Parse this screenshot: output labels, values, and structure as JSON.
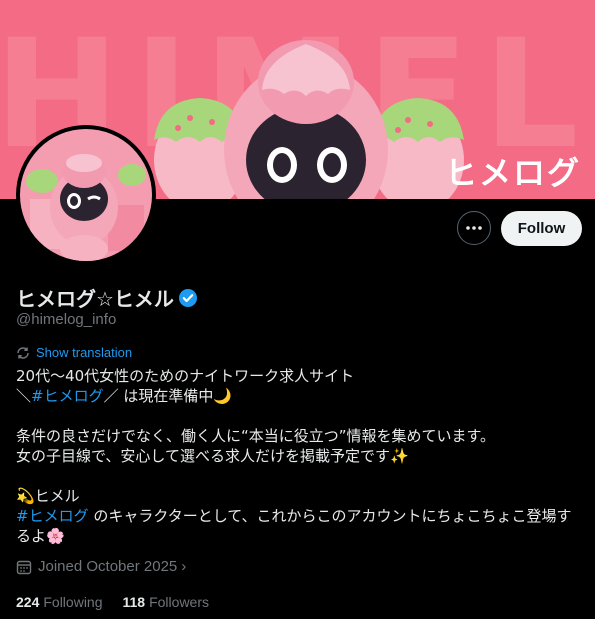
{
  "banner": {
    "background_text": "HIMELOG",
    "logo_text": "ヒメログ"
  },
  "profile": {
    "name": "ヒメログ☆ヒメル",
    "handle": "@himelog_info",
    "verified": true
  },
  "actions": {
    "more_icon": "more-dots-icon",
    "follow_label": "Follow"
  },
  "translate_label": "Show translation",
  "bio": {
    "line1": "20代〜40代女性のためのナイトワーク求人サイト",
    "line2_prefix": "＼",
    "line2_tag": "#ヒメログ",
    "line2_suffix": "／ は現在準備中🌙",
    "line3": "条件の良さだけでなく、働く人に“本当に役立つ”情報を集めています。",
    "line4": "女の子目線で、安心して選べる求人だけを掲載予定です✨",
    "line5": "💫ヒメル",
    "line6_tag": "#ヒメログ",
    "line6_text": " のキャラクターとして、これからこのアカウントにちょこちょこ登場す",
    "line7": "るよ🌸"
  },
  "joined": "Joined October 2025",
  "stats": {
    "following_count": "224",
    "following_label": "Following",
    "followers_count": "118",
    "followers_label": "Followers"
  },
  "colors": {
    "banner": "#f36b84",
    "link": "#1d9bf0",
    "muted": "#71767b",
    "text": "#e7e9ea"
  }
}
